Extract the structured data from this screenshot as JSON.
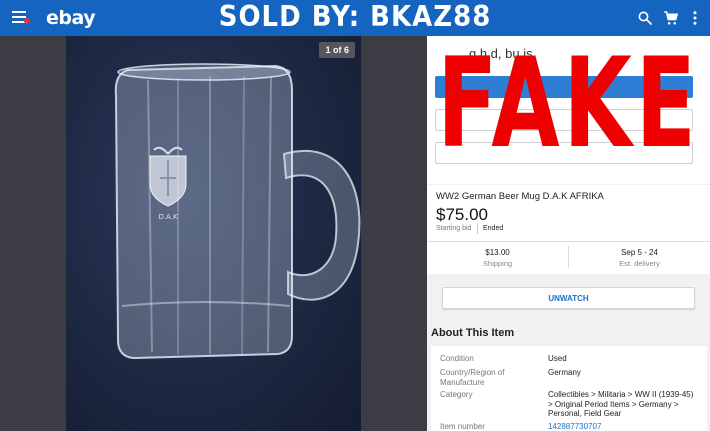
{
  "header": {
    "logo": "ebay",
    "banner": "SOLD BY: BKAZ88"
  },
  "colors": {
    "topbar": "#1565c0",
    "link": "#1a73c7",
    "fake_overlay": "#ee0000"
  },
  "icons": {
    "menu": "hamburger-menu-icon",
    "search": "search-icon",
    "cart": "cart-icon",
    "more": "more-vert-icon"
  },
  "gallery": {
    "counter": "1 of 6"
  },
  "listing": {
    "snippet": "g h     d, bu     is",
    "overlay": "FAKE",
    "title": "WW2 German Beer Mug D.A.K AFRIKA",
    "price": "$75.00",
    "bid_label": "Starting bid",
    "status": "Ended",
    "shipping_value": "$13.00",
    "shipping_label": "Shipping",
    "delivery_value": "Sep 5 - 24",
    "delivery_label": "Est. delivery",
    "unwatch": "UNWATCH"
  },
  "about": {
    "title": "About This Item",
    "specs": [
      {
        "key": "Condition",
        "value": "Used"
      },
      {
        "key": "Country/Region of Manufacture",
        "value": "Germany"
      },
      {
        "key": "Category",
        "value": "Collectibles > Militaria > WW II (1939-45) > Original Period Items > Germany > Personal, Field Gear"
      },
      {
        "key": "Item number",
        "value": "142887730707"
      }
    ]
  }
}
